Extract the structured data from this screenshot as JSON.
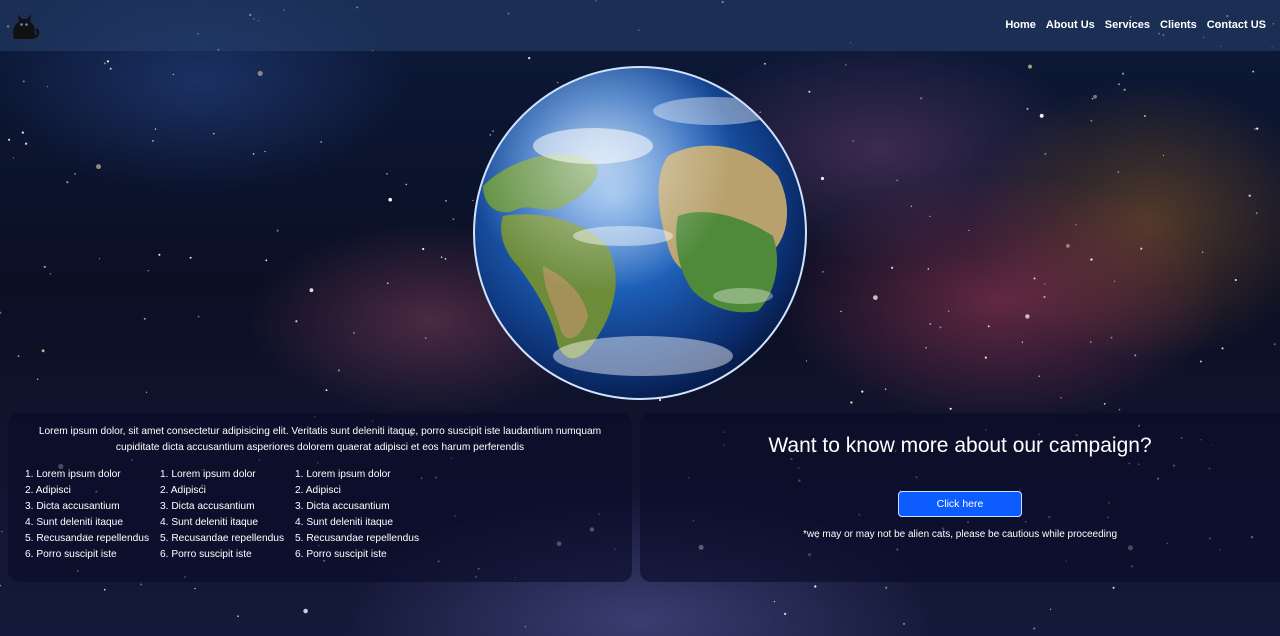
{
  "nav": {
    "logo_icon": "black-cat-logo-icon",
    "links": [
      "Home",
      "About Us",
      "Services",
      "Clients",
      "Contact US"
    ]
  },
  "hero": {
    "image_icon": "earth-globe-image"
  },
  "info_panel": {
    "intro": "Lorem ipsum dolor, sit amet consectetur adipisicing elit. Veritatis sunt deleniti itaque, porro suscipit iste laudantium numquam cupiditate dicta accusantium asperiores dolorem quaerat adipisci et eos harum perferendis",
    "lists": [
      [
        "1. Lorem ipsum dolor",
        "2. Adipisci",
        "3. Dicta accusantium",
        "4. Sunt deleniti itaque",
        "5. Recusandae repellendus",
        "6. Porro suscipit iste"
      ],
      [
        "1. Lorem ipsum dolor",
        "2. Adipisci",
        "3. Dicta accusantium",
        "4. Sunt deleniti itaque",
        "5. Recusandae repellendus",
        "6. Porro suscipit iste"
      ],
      [
        "1. Lorem ipsum dolor",
        "2. Adipisci",
        "3. Dicta accusantium",
        "4. Sunt deleniti itaque",
        "5. Recusandae repellendus",
        "6. Porro suscipit iste"
      ]
    ]
  },
  "cta_panel": {
    "heading": "Want to know more about our campaign?",
    "button_label": "Click here",
    "disclaimer": "*we may or may not be alien cats, please be cautious while proceeding"
  },
  "colors": {
    "button": "#0d5cff",
    "navbar": "#28416e",
    "panel": "#0a0c28"
  }
}
